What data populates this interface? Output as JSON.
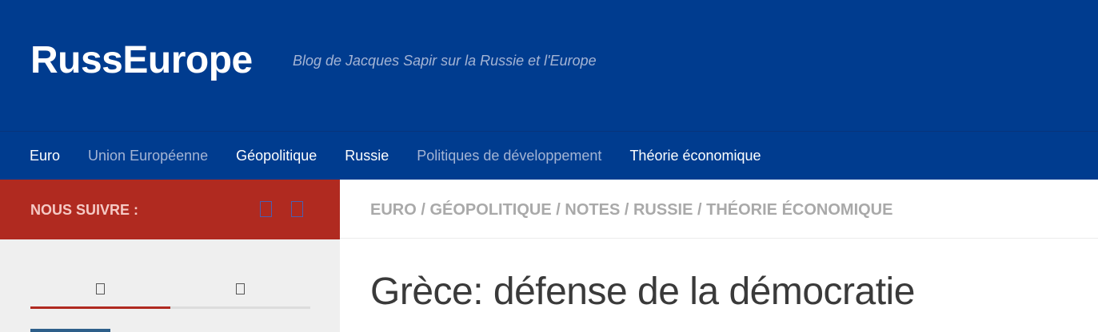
{
  "header": {
    "site_title": "RussEurope",
    "tagline": "Blog de Jacques Sapir sur la Russie et l'Europe"
  },
  "nav": {
    "items": [
      {
        "label": "Euro",
        "state": "active"
      },
      {
        "label": "Union Européenne",
        "state": "muted"
      },
      {
        "label": "Géopolitique",
        "state": "active"
      },
      {
        "label": "Russie",
        "state": "active"
      },
      {
        "label": "Politiques de développement",
        "state": "muted"
      },
      {
        "label": "Théorie économique",
        "state": "active"
      }
    ]
  },
  "follow": {
    "label": "NOUS SUIVRE :",
    "icons": [
      "social-icon-1",
      "social-icon-2"
    ]
  },
  "sidebar": {
    "tab_icons": [
      "sidebar-tab-1-icon",
      "sidebar-tab-2-icon"
    ],
    "active_tab_index": 0
  },
  "breadcrumb": {
    "items": [
      "Euro",
      "Géopolitique",
      "Notes",
      "Russie",
      "Théorie économique"
    ],
    "separator": " / "
  },
  "post": {
    "title": "Grèce: défense de la démocratie"
  },
  "colors": {
    "header_bg": "#003c8f",
    "follow_bg": "#b02a20",
    "sidebar_bg": "#efefef",
    "tagline": "#a4b4d4"
  }
}
